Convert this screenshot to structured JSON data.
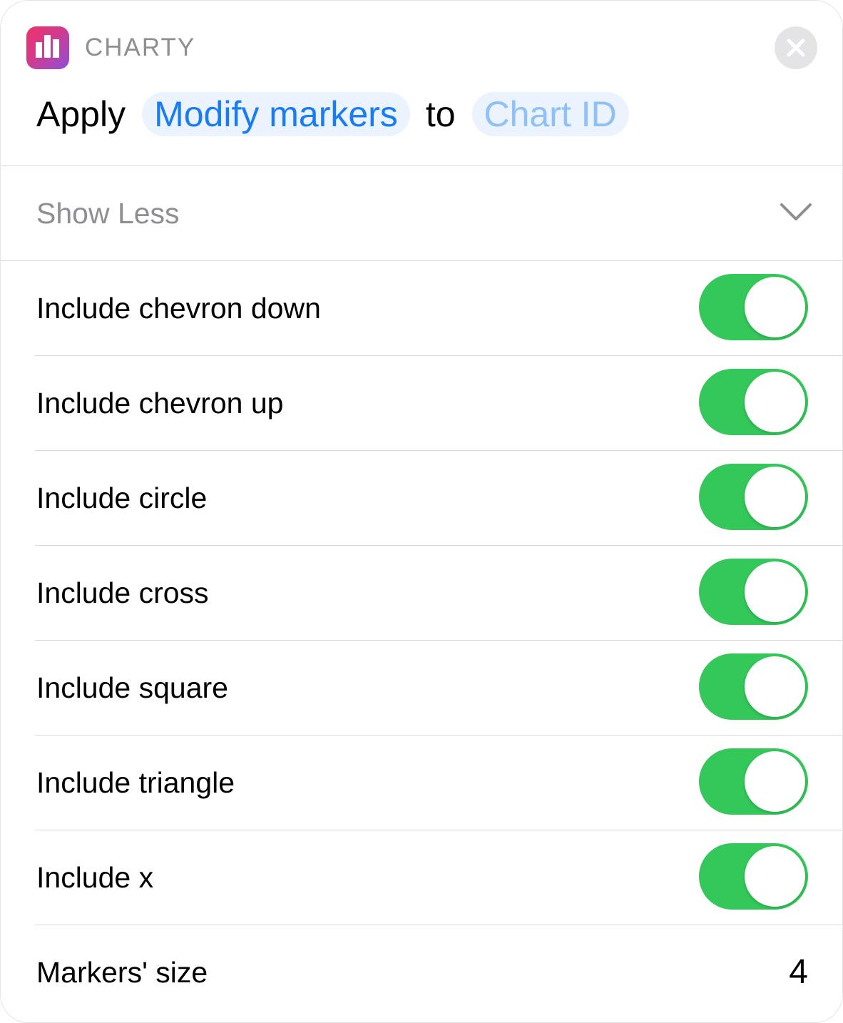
{
  "app": {
    "name": "CHARTY",
    "icon": "bar-chart-icon"
  },
  "action": {
    "verb": "Apply",
    "action_token": "Modify markers",
    "connector": "to",
    "parameter_placeholder": "Chart ID"
  },
  "show_less": {
    "label": "Show Less",
    "icon": "chevron-down-icon"
  },
  "options": [
    {
      "label": "Include chevron down",
      "enabled": true
    },
    {
      "label": "Include chevron up",
      "enabled": true
    },
    {
      "label": "Include circle",
      "enabled": true
    },
    {
      "label": "Include cross",
      "enabled": true
    },
    {
      "label": "Include square",
      "enabled": true
    },
    {
      "label": "Include triangle",
      "enabled": true
    },
    {
      "label": "Include x",
      "enabled": true
    }
  ],
  "markers_size": {
    "label": "Markers' size",
    "value": "4"
  },
  "colors": {
    "toggle_on": "#34c759",
    "token_blue": "#1a7cf5",
    "placeholder_blue": "#8fc0f8",
    "token_background": "#eaf3fe",
    "secondary_text": "#8e8e93"
  }
}
